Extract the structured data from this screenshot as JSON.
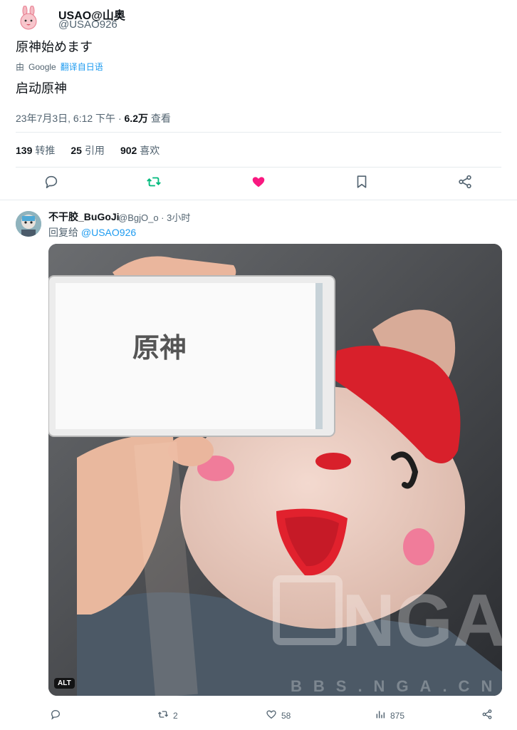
{
  "tweet": {
    "display_name": "USAO@山奥",
    "handle": "@USAO926",
    "text": "原神始めます",
    "translate_by": "由",
    "translate_brand": "Google",
    "translate_link": "翻译自日语",
    "translated_text": "启动原神",
    "timestamp": "23年7月3日, 6:12 下午 · ",
    "views_count": "6.2万",
    "views_label": " 查看",
    "retweets_count": "139",
    "retweets_label": "转推",
    "quotes_count": "25",
    "quotes_label": "引用",
    "likes_count": "902",
    "likes_label": "喜欢"
  },
  "reply": {
    "display_name": "不干胶_BuGoJi",
    "handle": "@BgjO_o · 3小时",
    "reply_prefix": "回复给 ",
    "reply_mention": "@USAO926",
    "image_alt_badge": "ALT",
    "phone_screen_logo": "原神",
    "watermark_logo": "NGA",
    "watermark_site": "BBS.NGA.CN",
    "retweets": "2",
    "likes": "58",
    "views": "875"
  },
  "colors": {
    "accent_blue": "#1d9bf0",
    "retweet_green": "#00ba7c",
    "like_pink": "#f91880",
    "secondary_text": "#536471"
  },
  "icons": [
    "bunny-avatar",
    "reply-icon",
    "retweet-icon",
    "heart-icon",
    "bookmark-icon",
    "share-icon",
    "views-icon"
  ]
}
